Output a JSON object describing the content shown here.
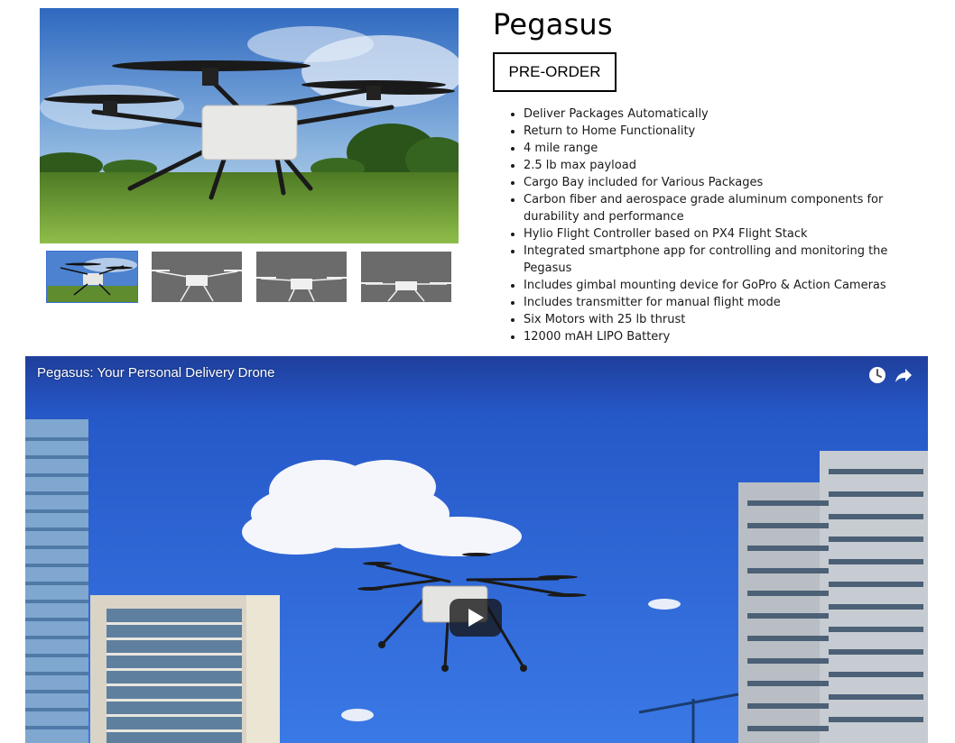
{
  "product": {
    "title": "Pegasus",
    "preorder_label": "PRE-ORDER",
    "features": [
      "Deliver Packages Automatically",
      "Return to Home Functionality",
      "4 mile range",
      "2.5 lb max payload",
      "Cargo Bay included for Various Packages",
      "Carbon fiber and aerospace grade aluminum components for durability and performance",
      "Hylio Flight Controller based on PX4 Flight Stack",
      "Integrated smartphone app for controlling and monitoring the Pegasus",
      "Includes gimbal mounting device for GoPro & Action Cameras",
      "Includes transmitter for manual flight mode",
      "Six Motors with 25 lb thrust",
      "12000 mAH LIPO Battery"
    ]
  },
  "gallery": {
    "thumbnails": [
      "drone-photo-color",
      "drone-photo-gray",
      "drone-photo-gray",
      "drone-photo-gray"
    ],
    "selected_index": 0
  },
  "video": {
    "title": "Pegasus: Your Personal Delivery Drone",
    "icons": [
      "watch-later-icon",
      "share-icon",
      "play-icon"
    ]
  },
  "colors": {
    "sky": "#3f78c9",
    "grass": "#5d8a2e",
    "video_sky": "#2d63d6",
    "button_border": "#000000"
  }
}
